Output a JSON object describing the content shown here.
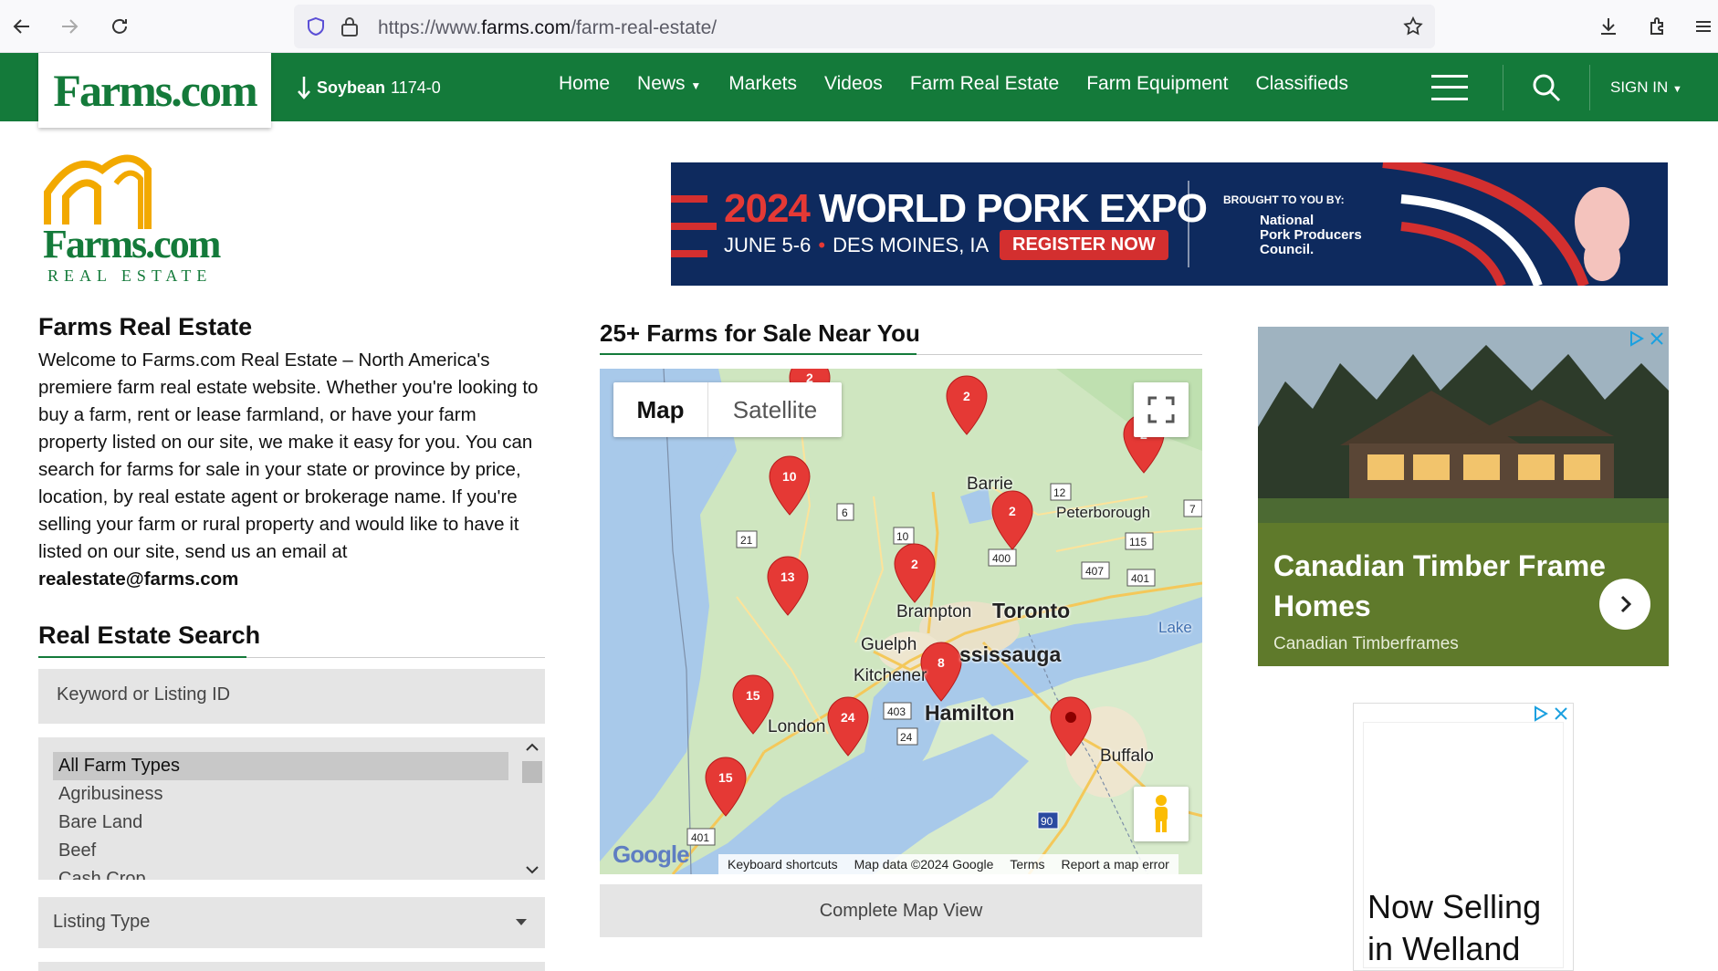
{
  "browser": {
    "url_prefix": "https://www.",
    "url_domain": "farms.com",
    "url_path": "/farm-real-estate/"
  },
  "nav": {
    "logo": "Farms.com",
    "ticker_name": "Soybean",
    "ticker_value": "1174-0",
    "links": [
      "Home",
      "News",
      "Markets",
      "Videos",
      "Farm Real Estate",
      "Farm Equipment",
      "Classifieds"
    ],
    "signin": "SIGN IN"
  },
  "left": {
    "logo_brand": "Farms.com",
    "logo_sub": "REAL ESTATE",
    "heading": "Farms Real Estate",
    "intro": "Welcome to Farms.com Real Estate – North America's premiere farm real estate website. Whether you're looking to buy a farm, rent or lease farmland, or have your farm property listed on our site, we make it easy for you. You can search for farms for sale in your state or province by price, location, by real estate agent or brokerage name. If you're selling your farm or rural property and would like to have it listed on our site, send us an email at",
    "email": "realestate@farms.com",
    "search_heading": "Real Estate Search",
    "keyword_placeholder": "Keyword or Listing ID",
    "farm_types": [
      "All Farm Types",
      "Agribusiness",
      "Bare Land",
      "Beef",
      "Cash Crop"
    ],
    "listing_type": "Listing Type"
  },
  "banner": {
    "year": "2024",
    "title": "WORLD PORK EXPO",
    "dates": "JUNE 5-6",
    "location": "DES MOINES, IA",
    "cta": "REGISTER NOW",
    "brought": "BROUGHT TO YOU BY:",
    "sponsor_1": "National",
    "sponsor_2": "Pork Producers",
    "sponsor_3": "Council."
  },
  "map": {
    "heading": "25+ Farms for Sale Near You",
    "toggle_map": "Map",
    "toggle_satellite": "Satellite",
    "google": "Google",
    "footer": [
      "Keyboard shortcuts",
      "Map data ©2024 Google",
      "Terms",
      "Report a map error"
    ],
    "complete_button": "Complete Map View",
    "cities": {
      "barrie": "Barrie",
      "peterborough": "Peterborough",
      "brampton": "Brampton",
      "toronto": "Toronto",
      "guelph": "Guelph",
      "mississauga": "ssissauga",
      "kitchener": "Kitchener",
      "hamilton": "Hamilton",
      "london": "London",
      "buffalo": "Buffalo",
      "lake": "Lake"
    },
    "road_shields": [
      "6",
      "21",
      "10",
      "12",
      "115",
      "407",
      "401",
      "400",
      "7",
      "403",
      "24",
      "401",
      "90"
    ],
    "markers": [
      "2",
      "2",
      "2",
      "10",
      "2",
      "2",
      "13",
      "8",
      "15",
      "24",
      "15"
    ]
  },
  "ads": {
    "ad1_title": "Canadian Timber Frame Homes",
    "ad1_sub": "Canadian Timberframes",
    "ad2_title": "Now Selling in Welland"
  },
  "colors": {
    "brand_green": "#147a3a",
    "logo_orange": "#f2a900",
    "marker_red": "#e53935"
  }
}
